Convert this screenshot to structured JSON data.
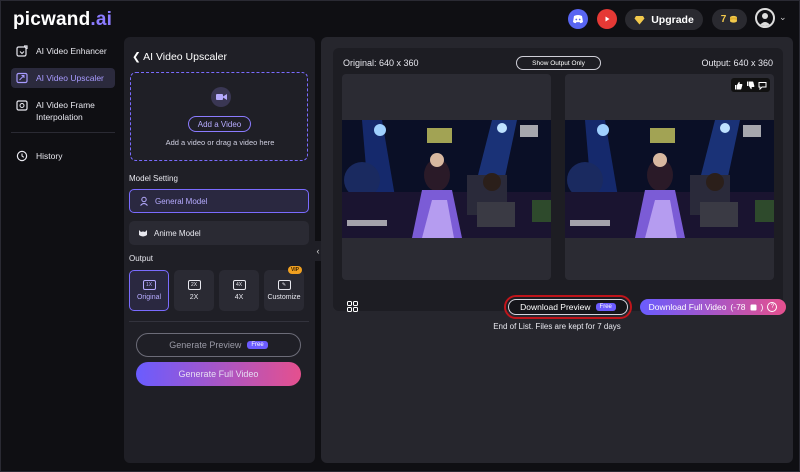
{
  "app": {
    "logo_main": "picwand",
    "logo_suffix": ".ai",
    "upgrade_label": "Upgrade",
    "credits": "7"
  },
  "nav": {
    "items": [
      {
        "label": "AI Video Enhancer",
        "icon": "enhancer-icon"
      },
      {
        "label": "AI Video Upscaler",
        "icon": "upscaler-icon",
        "active": true
      },
      {
        "label": "AI Video Frame Interpolation",
        "icon": "interpolation-icon"
      },
      {
        "label": "History",
        "icon": "history-icon"
      }
    ]
  },
  "panel": {
    "title": "AI Video Upscaler",
    "add_video_label": "Add a Video",
    "drop_hint": "Add a video or drag a video here",
    "model_setting_label": "Model Setting",
    "models": [
      {
        "label": "General Model",
        "active": true
      },
      {
        "label": "Anime Model"
      }
    ],
    "output_label": "Output",
    "outputs": [
      {
        "badge": "1X",
        "label": "Original",
        "active": true
      },
      {
        "badge": "2X",
        "label": "2X"
      },
      {
        "badge": "4X",
        "label": "4X"
      },
      {
        "badge": "✎",
        "label": "Customize",
        "vip": "VIP"
      }
    ],
    "generate_preview_label": "Generate Preview",
    "free_badge": "Free",
    "generate_full_label": "Generate Full Video"
  },
  "main": {
    "original_label": "Original: 640 x 360",
    "output_label": "Output: 640 x 360",
    "show_output_label": "Show Output Only",
    "download_preview_label": "Download Preview",
    "download_free_badge": "Free",
    "download_full_label": "Download Full Video",
    "download_full_cost": "(-78",
    "download_full_cost_end": ")",
    "end_note": "End of List. Files are kept for 7 days"
  },
  "colors": {
    "accent": "#7a6bff",
    "gradient_start": "#6a5cff",
    "gradient_end": "#e5508e",
    "highlight_box": "#c0151b"
  }
}
